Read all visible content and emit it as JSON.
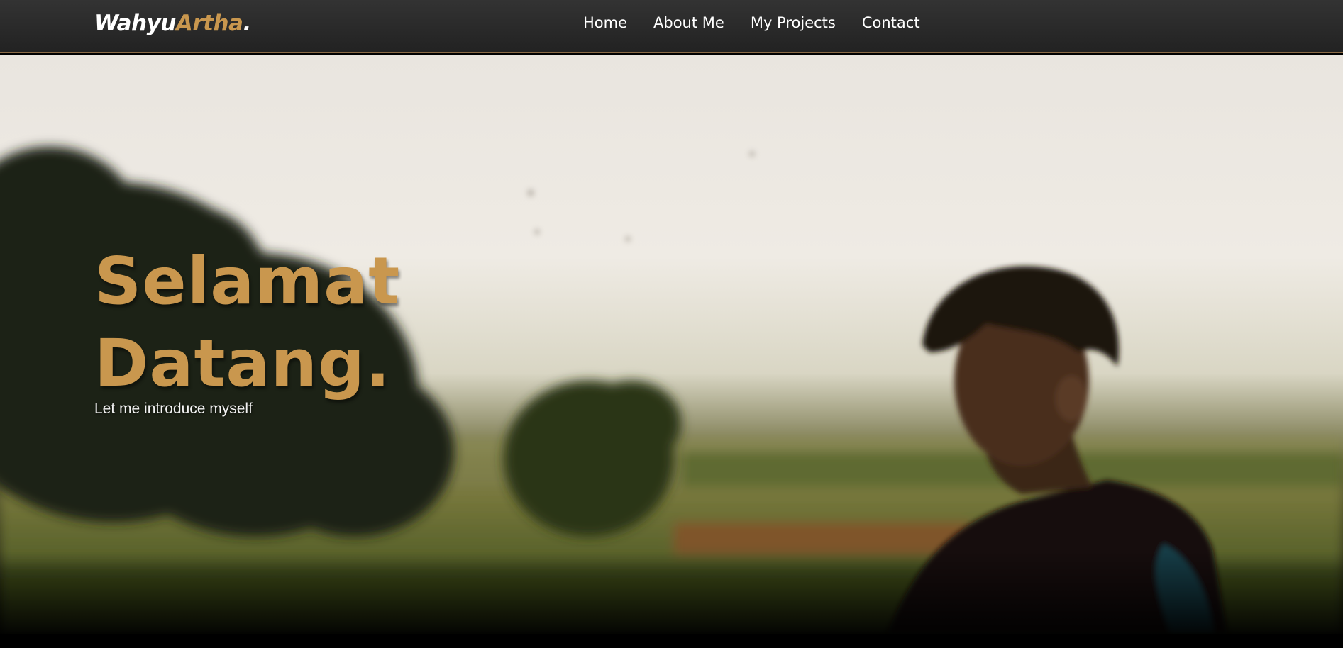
{
  "brand": {
    "first": "Wahyu",
    "second": "Artha",
    "dot": "."
  },
  "nav": {
    "items": [
      {
        "label": "Home"
      },
      {
        "label": "About Me"
      },
      {
        "label": "My Projects"
      },
      {
        "label": "Contact"
      }
    ]
  },
  "hero": {
    "title_line1": "Selamat",
    "title_line2": "Datang.",
    "subtitle": "Let me introduce myself"
  },
  "colors": {
    "accent": "#c9974e",
    "navbar": "#2b2b2b",
    "text": "#ffffff"
  }
}
